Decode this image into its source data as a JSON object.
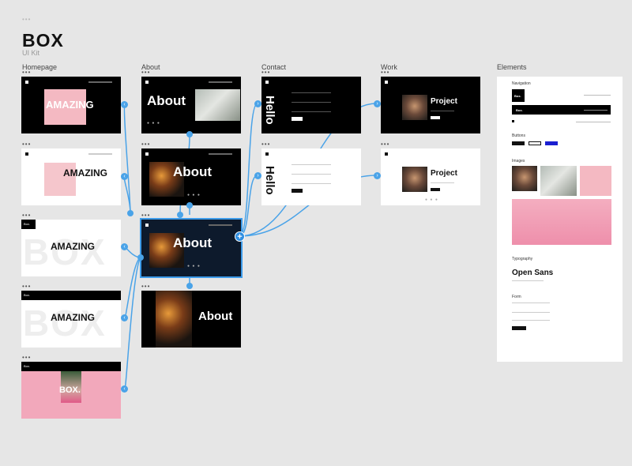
{
  "header": {
    "title": "BOX",
    "subtitle": "UI Kit"
  },
  "columns": {
    "homepage": "Homepage",
    "about": "About",
    "contact": "Contact",
    "work": "Work",
    "elements": "Elements"
  },
  "options_glyph": "•••",
  "frames": {
    "homepage_1": {
      "headline": "AMAZING"
    },
    "homepage_2": {
      "headline": "AMAZING"
    },
    "homepage_3": {
      "logo": "Box.",
      "headline": "AMAZING",
      "watermark": "BOX"
    },
    "homepage_4": {
      "logo": "Box.",
      "headline": "AMAZING",
      "watermark": "BOX"
    },
    "homepage_5": {
      "logo": "Box.",
      "headline": "BOX."
    },
    "about_1": {
      "headline": "About"
    },
    "about_2": {
      "headline": "About"
    },
    "about_3": {
      "headline": "About"
    },
    "about_4": {
      "headline": "About"
    },
    "contact_1": {
      "headline": "Hello"
    },
    "contact_2": {
      "headline": "Hello"
    },
    "work_1": {
      "headline": "Project"
    },
    "work_2": {
      "headline": "Project"
    }
  },
  "elements_panel": {
    "navigation": "Navigation",
    "nav_logo_1": "Box.",
    "nav_logo_2": "Box.",
    "buttons": "Buttons",
    "images": "Images",
    "typography": "Typography",
    "font_name": "Open Sans",
    "form": "Form"
  },
  "link_glyph": "‹",
  "link_glyph_right": "›",
  "plus_glyph": "+",
  "colors": {
    "canvas": "#e6e6e6",
    "link": "#4aa3e8",
    "selected_frame": "#0d1a2c",
    "button_accent": "#1a1fd0"
  }
}
